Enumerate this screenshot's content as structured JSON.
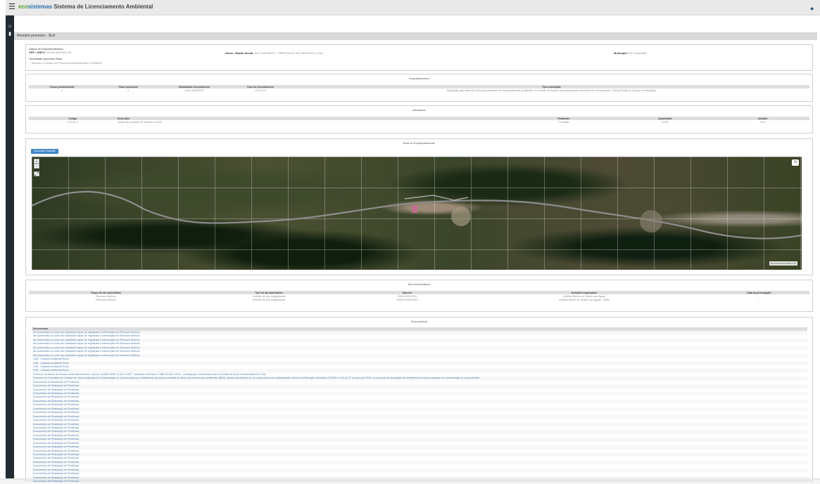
{
  "app": {
    "brand_prefix": "eco",
    "brand_mid": "sistemas",
    "title": "Sistema de Licenciamento Ambiental"
  },
  "process": {
    "header": "Resumo processo - SLA"
  },
  "enterprise": {
    "data_label": "Dados do Empreendimento",
    "cpf_label": "CPF / CNPJ:",
    "cpf_value": "00.000.000/0001-00",
    "name_label": "Nome / Razão Social:",
    "name_value": "SM CONCRETO - PRESTACAO DE SERVICOS LTDA",
    "municipio_label": "Município:",
    "municipio_value": "Rio Casca/MG",
    "vinculacao_label": "Vinculação processo Siam",
    "vinculacao_value": "Informe o número do Processo Administrativo: 00000/00"
  },
  "framing": {
    "title": "Enquadramento",
    "headers": [
      "Classe predominante",
      "Fator locacional",
      "Modalidade licenciamento",
      "Fase do licenciamento",
      "Tipo solicitação"
    ],
    "row": [
      "2",
      "0",
      "LAS CADASTRO",
      "LP+LI+LO",
      "Solicitação para obtenção de licença ambiental de empreendimento já detentor, em caráter de licença, das licenciamento ambiental de Licenciamento, Licença Prévia ou Licença de instalação."
    ]
  },
  "activities": {
    "title": "Atividades",
    "headers": [
      "Código",
      "Descrição",
      "Parâmetro",
      "Quantidade",
      "Unidade"
    ],
    "row": [
      "C-10-01-4",
      "Usinas de produção de concreto comum",
      "Produção",
      "6,000",
      "m³/h"
    ]
  },
  "area": {
    "title": "Área do Empreendimento",
    "download_label": "Download Shapefile",
    "coords": "20°17'31.5\"S 42°30'47.7\"W"
  },
  "acts": {
    "title": "Atos Autorizativos",
    "headers": [
      "Grupo do ato autorizativo",
      "Tipo do ato autorizativo",
      "Número",
      "Entidade responsável",
      "Data da prorrogação"
    ],
    "rows": [
      [
        "Recursos Hídricos",
        "Certidão de Uso Insignificante",
        "00001/2020/2019",
        "Instituto Mineiro de Gestão das Águas",
        "-"
      ],
      [
        "Recursos Hídricos",
        "Certidão de Uso Insignificante",
        "00000/7/2020/2019",
        "Instituto Mineiro de Gestão das Águas - IGAM",
        "-"
      ]
    ]
  },
  "documents": {
    "title": "Documentos",
    "header": "Documentos",
    "rows": [
      "Ato Autorizativo ou outro ato subsidiário capaz de regularizar a intervenção em Recursos Hídricos",
      "Ato Autorizativo ou outro ato subsidiário capaz de regularizar a intervenção em Recursos Hídricos",
      "Ato Autorizativo ou outro ato subsidiário capaz de regularizar a intervenção em Recursos Hídricos",
      "Ato Autorizativo ou outro ato subsidiário capaz de regularizar a intervenção em Recursos Hídricos",
      "Ato Autorizativo ou outro ato subsidiário capaz de regularizar a intervenção em Recursos Hídricos",
      "Ato Autorizativo ou outro ato subsidiário capaz de regularizar a intervenção em Recursos Hídricos",
      "Ato Autorizativo ou outro ato subsidiário capaz de regularizar a intervenção em Recursos Hídricos",
      "CAR - Cadastro Ambiental Rural",
      "CAR - Cadastro Ambiental Rural",
      "CAR - Cadastro Ambiental Rural",
      "CAR - Cadastro Ambiental Rural",
      "Protocolo de estudo de Passivo Ambiental conforme normas da ABNT NBR 15.515-1:2007 - Avaliação Preliminar e NBR 15.515-2:2011 - Investigação Confirmatória para a Gestão de Áreas Contaminadas em Fase",
      "Protocolo do Formulário de Cadastro de Áreas Suspeitas de Contaminação ou Contaminadas por Substâncias Químicas constante no Banco de Declarações Ambientais (BDA), quando identificado um ou mais indícios de contaminação conforme Deliberação Normativa COPAM nº 116, de 27 de junho de 2008, ou protocolo da declaração de inexistência de áreas suspeitas de contaminação ou contaminadas",
      "Documentos de Realização de Pendência",
      "Documentos de Realização de Pendência",
      "Documentos de Realização de Pendência",
      "Documentos de Realização de Pendência",
      "Documentos de Realização de Pendência",
      "Documentos de Realização de Pendência",
      "Documentos de Realização de Pendência",
      "Documentos de Realização de Pendência",
      "Documentos de Realização de Pendência",
      "Documentos de Realização de Pendência",
      "Documentos de Realização de Pendência",
      "Documentos de Realização de Pendência",
      "Documentos de Realização de Pendência",
      "Documentos de Realização de Pendência",
      "Documentos de Realização de Pendência",
      "Documentos de Realização de Pendência",
      "Documentos de Realização de Pendência",
      "Documentos de Realização de Pendência",
      "Documentos de Realização de Pendência",
      "Documentos de Realização de Pendência",
      "Documentos de Realização de Pendência",
      "Documentos de Realização de Pendência",
      "Documentos de Realização de Pendência",
      "Documentos de Realização de Pendência",
      "Documentos de Realização de Pendência",
      "Documentos de Realização de Pendência",
      "Documentos de Realização de Pendência"
    ]
  },
  "icons": {
    "menu": "hamburger-icon",
    "user": "user-icon",
    "home": "home-icon",
    "folder": "folder-icon",
    "layers": "layers-icon"
  }
}
